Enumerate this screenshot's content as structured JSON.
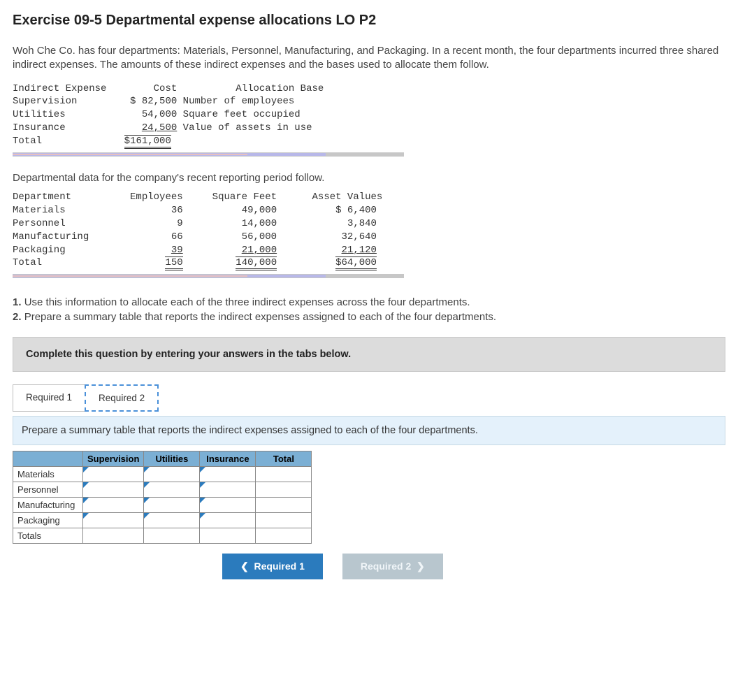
{
  "title": "Exercise 09-5 Departmental expense allocations LO P2",
  "intro": "Woh Che Co. has four departments: Materials, Personnel, Manufacturing, and Packaging. In a recent month, the four departments incurred three shared indirect expenses. The amounts of these indirect expenses and the bases used to allocate them follow.",
  "expense_table": {
    "headers": {
      "c1": "Indirect Expense",
      "c2": "Cost",
      "c3": "Allocation Base"
    },
    "rows": [
      {
        "name": "Supervision",
        "cost": "$ 82,500",
        "base": "Number of employees"
      },
      {
        "name": "Utilities",
        "cost": "54,000",
        "base": "Square feet occupied"
      },
      {
        "name": "Insurance",
        "cost": "24,500",
        "base": "Value of assets in use"
      }
    ],
    "total_label": "Total",
    "total_value": "$161,000"
  },
  "intro2": "Departmental data for the company's recent reporting period follow.",
  "dept_table": {
    "headers": {
      "c1": "Department",
      "c2": "Employees",
      "c3": "Square Feet",
      "c4": "Asset Values"
    },
    "rows": [
      {
        "name": "Materials",
        "emp": "36",
        "sqft": "49,000",
        "assets": "$ 6,400"
      },
      {
        "name": "Personnel",
        "emp": "9",
        "sqft": "14,000",
        "assets": "3,840"
      },
      {
        "name": "Manufacturing",
        "emp": "66",
        "sqft": "56,000",
        "assets": "32,640"
      },
      {
        "name": "Packaging",
        "emp": "39",
        "sqft": "21,000",
        "assets": "21,120"
      }
    ],
    "total_label": "Total",
    "totals": {
      "emp": "150",
      "sqft": "140,000",
      "assets": "$64,000"
    }
  },
  "instructions": {
    "n1": "1.",
    "t1": "Use this information to allocate each of the three indirect expenses across the four departments.",
    "n2": "2.",
    "t2": "Prepare a summary table that reports the indirect expenses assigned to each of the four departments."
  },
  "taskline": "Complete this question by entering your answers in the tabs below.",
  "tabs": {
    "t1": "Required 1",
    "t2": "Required 2"
  },
  "tab_instruction": "Prepare a summary table that reports the indirect expenses assigned to each of the four departments.",
  "entry_table": {
    "cols": [
      "Supervision",
      "Utilities",
      "Insurance",
      "Total"
    ],
    "rows": [
      "Materials",
      "Personnel",
      "Manufacturing",
      "Packaging",
      "Totals"
    ]
  },
  "nav": {
    "prev": "Required 1",
    "next": "Required 2",
    "chev_left": "❮",
    "chev_right": "❯"
  }
}
